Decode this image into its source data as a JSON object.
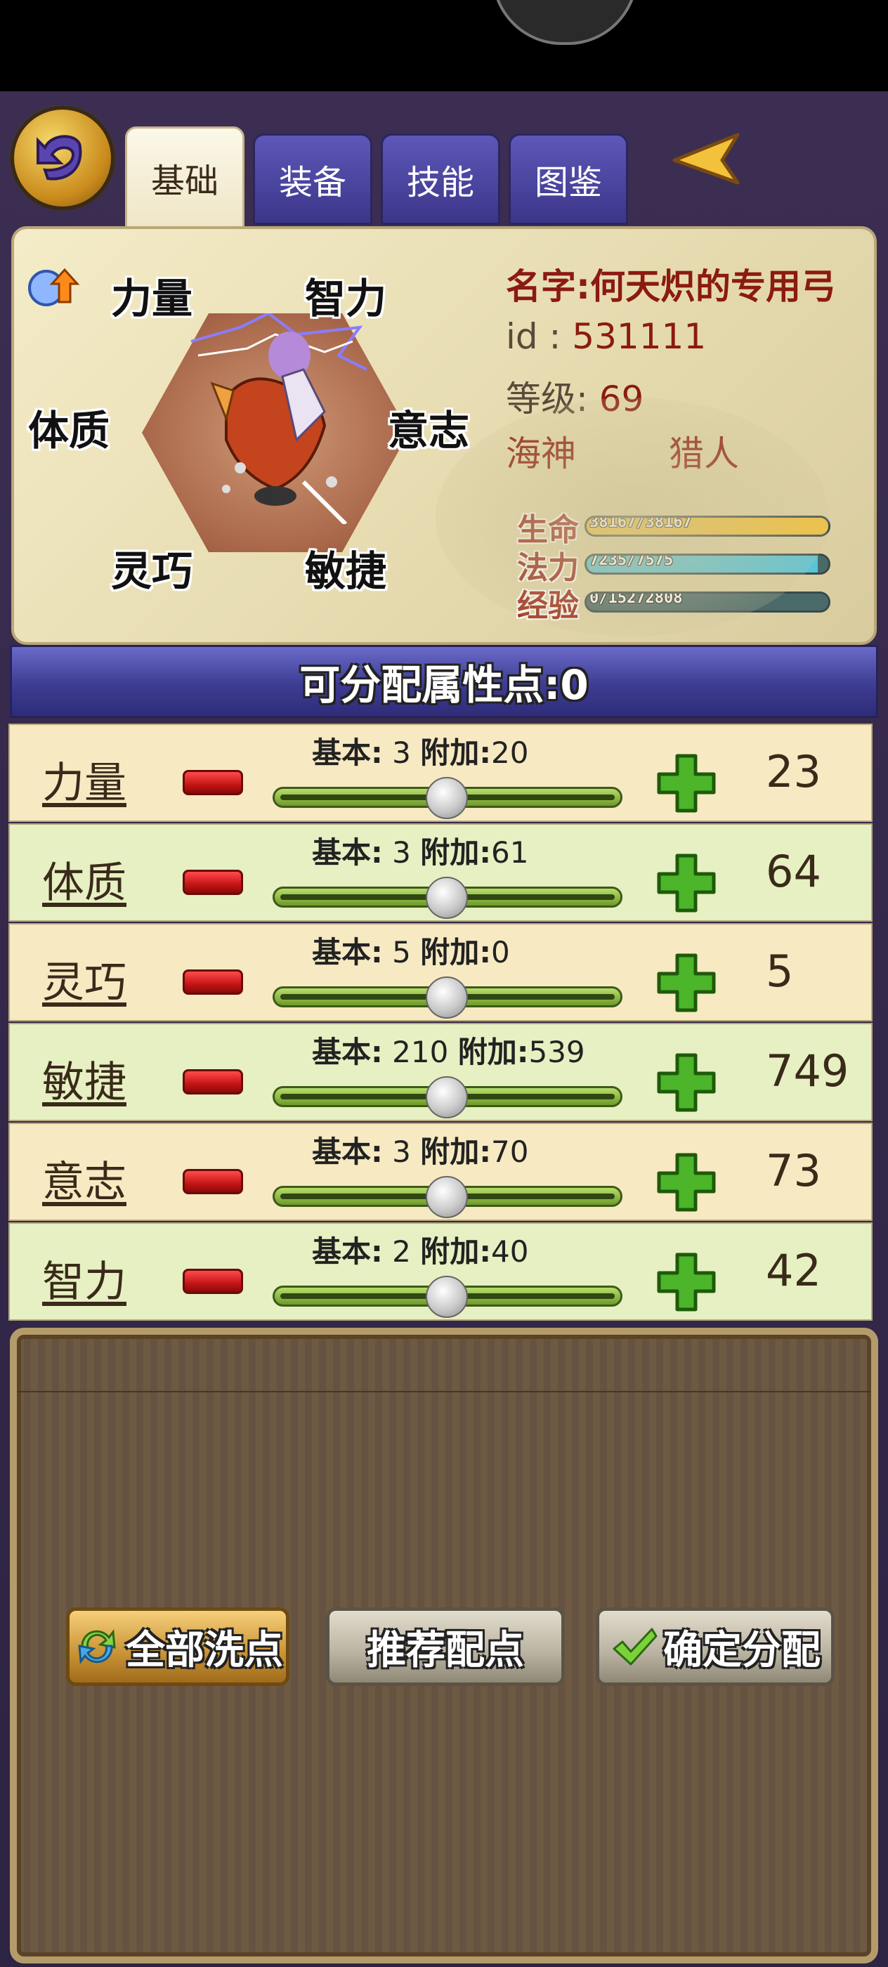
{
  "tabs": [
    {
      "label": "基础",
      "active": true
    },
    {
      "label": "装备",
      "active": false
    },
    {
      "label": "技能",
      "active": false
    },
    {
      "label": "图鉴",
      "active": false
    }
  ],
  "hexagon": {
    "labels": {
      "top_left": "力量",
      "top_right": "智力",
      "left": "体质",
      "right": "意志",
      "bottom_left": "灵巧",
      "bottom_right": "敏捷"
    }
  },
  "character": {
    "name_line": "名字:何天炽的专用弓",
    "id_label": "id : ",
    "id_value": "531111",
    "level_label": "等级: ",
    "level_value": "69",
    "race": "海神",
    "class": "猎人"
  },
  "bars": [
    {
      "label": "生命",
      "text": "38167/38167",
      "fill": 1.0,
      "color": "#f2c23a"
    },
    {
      "label": "法力",
      "text": "7235/7575",
      "fill": 0.955,
      "color": "#56c4d9"
    },
    {
      "label": "经验",
      "text": "0/15272808",
      "fill": 0.0,
      "color": "#4a6a6a"
    }
  ],
  "points": {
    "text": "可分配属性点:0"
  },
  "attributes": [
    {
      "name": "力量",
      "basic_label": "基本:",
      "basic": "3",
      "extra_label": "附加:",
      "extra": "20",
      "total": "23"
    },
    {
      "name": "体质",
      "basic_label": "基本:",
      "basic": "3",
      "extra_label": "附加:",
      "extra": "61",
      "total": "64"
    },
    {
      "name": "灵巧",
      "basic_label": "基本:",
      "basic": "5",
      "extra_label": "附加:",
      "extra": "0",
      "total": "5"
    },
    {
      "name": "敏捷",
      "basic_label": "基本:",
      "basic": "210",
      "extra_label": "附加:",
      "extra": "539",
      "total": "749"
    },
    {
      "name": "意志",
      "basic_label": "基本:",
      "basic": "3",
      "extra_label": "附加:",
      "extra": "70",
      "total": "73"
    },
    {
      "name": "智力",
      "basic_label": "基本:",
      "basic": "2",
      "extra_label": "附加:",
      "extra": "40",
      "total": "42"
    }
  ],
  "buttons": {
    "reset_all": "全部洗点",
    "recommend": "推荐配点",
    "confirm": "确定分配"
  },
  "icons": {
    "back": "back-arrow-icon",
    "collapse": "triangle-left-icon",
    "level_up": "level-up-icon",
    "minus": "minus-icon",
    "plus": "plus-icon",
    "reset": "refresh-icon",
    "confirm": "checkmark-icon"
  }
}
